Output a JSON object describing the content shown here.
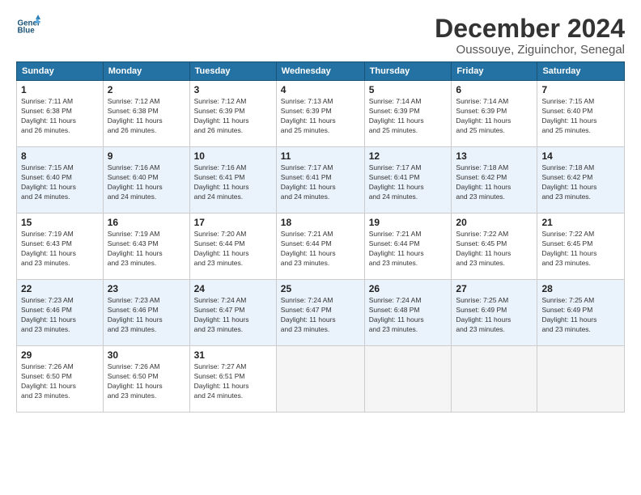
{
  "logo": {
    "line1": "General",
    "line2": "Blue"
  },
  "title": "December 2024",
  "location": "Oussouye, Ziguinchor, Senegal",
  "days_of_week": [
    "Sunday",
    "Monday",
    "Tuesday",
    "Wednesday",
    "Thursday",
    "Friday",
    "Saturday"
  ],
  "weeks": [
    [
      {
        "day": "1",
        "info": "Sunrise: 7:11 AM\nSunset: 6:38 PM\nDaylight: 11 hours\nand 26 minutes."
      },
      {
        "day": "2",
        "info": "Sunrise: 7:12 AM\nSunset: 6:38 PM\nDaylight: 11 hours\nand 26 minutes."
      },
      {
        "day": "3",
        "info": "Sunrise: 7:12 AM\nSunset: 6:39 PM\nDaylight: 11 hours\nand 26 minutes."
      },
      {
        "day": "4",
        "info": "Sunrise: 7:13 AM\nSunset: 6:39 PM\nDaylight: 11 hours\nand 25 minutes."
      },
      {
        "day": "5",
        "info": "Sunrise: 7:14 AM\nSunset: 6:39 PM\nDaylight: 11 hours\nand 25 minutes."
      },
      {
        "day": "6",
        "info": "Sunrise: 7:14 AM\nSunset: 6:39 PM\nDaylight: 11 hours\nand 25 minutes."
      },
      {
        "day": "7",
        "info": "Sunrise: 7:15 AM\nSunset: 6:40 PM\nDaylight: 11 hours\nand 25 minutes."
      }
    ],
    [
      {
        "day": "8",
        "info": "Sunrise: 7:15 AM\nSunset: 6:40 PM\nDaylight: 11 hours\nand 24 minutes."
      },
      {
        "day": "9",
        "info": "Sunrise: 7:16 AM\nSunset: 6:40 PM\nDaylight: 11 hours\nand 24 minutes."
      },
      {
        "day": "10",
        "info": "Sunrise: 7:16 AM\nSunset: 6:41 PM\nDaylight: 11 hours\nand 24 minutes."
      },
      {
        "day": "11",
        "info": "Sunrise: 7:17 AM\nSunset: 6:41 PM\nDaylight: 11 hours\nand 24 minutes."
      },
      {
        "day": "12",
        "info": "Sunrise: 7:17 AM\nSunset: 6:41 PM\nDaylight: 11 hours\nand 24 minutes."
      },
      {
        "day": "13",
        "info": "Sunrise: 7:18 AM\nSunset: 6:42 PM\nDaylight: 11 hours\nand 23 minutes."
      },
      {
        "day": "14",
        "info": "Sunrise: 7:18 AM\nSunset: 6:42 PM\nDaylight: 11 hours\nand 23 minutes."
      }
    ],
    [
      {
        "day": "15",
        "info": "Sunrise: 7:19 AM\nSunset: 6:43 PM\nDaylight: 11 hours\nand 23 minutes."
      },
      {
        "day": "16",
        "info": "Sunrise: 7:19 AM\nSunset: 6:43 PM\nDaylight: 11 hours\nand 23 minutes."
      },
      {
        "day": "17",
        "info": "Sunrise: 7:20 AM\nSunset: 6:44 PM\nDaylight: 11 hours\nand 23 minutes."
      },
      {
        "day": "18",
        "info": "Sunrise: 7:21 AM\nSunset: 6:44 PM\nDaylight: 11 hours\nand 23 minutes."
      },
      {
        "day": "19",
        "info": "Sunrise: 7:21 AM\nSunset: 6:44 PM\nDaylight: 11 hours\nand 23 minutes."
      },
      {
        "day": "20",
        "info": "Sunrise: 7:22 AM\nSunset: 6:45 PM\nDaylight: 11 hours\nand 23 minutes."
      },
      {
        "day": "21",
        "info": "Sunrise: 7:22 AM\nSunset: 6:45 PM\nDaylight: 11 hours\nand 23 minutes."
      }
    ],
    [
      {
        "day": "22",
        "info": "Sunrise: 7:23 AM\nSunset: 6:46 PM\nDaylight: 11 hours\nand 23 minutes."
      },
      {
        "day": "23",
        "info": "Sunrise: 7:23 AM\nSunset: 6:46 PM\nDaylight: 11 hours\nand 23 minutes."
      },
      {
        "day": "24",
        "info": "Sunrise: 7:24 AM\nSunset: 6:47 PM\nDaylight: 11 hours\nand 23 minutes."
      },
      {
        "day": "25",
        "info": "Sunrise: 7:24 AM\nSunset: 6:47 PM\nDaylight: 11 hours\nand 23 minutes."
      },
      {
        "day": "26",
        "info": "Sunrise: 7:24 AM\nSunset: 6:48 PM\nDaylight: 11 hours\nand 23 minutes."
      },
      {
        "day": "27",
        "info": "Sunrise: 7:25 AM\nSunset: 6:49 PM\nDaylight: 11 hours\nand 23 minutes."
      },
      {
        "day": "28",
        "info": "Sunrise: 7:25 AM\nSunset: 6:49 PM\nDaylight: 11 hours\nand 23 minutes."
      }
    ],
    [
      {
        "day": "29",
        "info": "Sunrise: 7:26 AM\nSunset: 6:50 PM\nDaylight: 11 hours\nand 23 minutes."
      },
      {
        "day": "30",
        "info": "Sunrise: 7:26 AM\nSunset: 6:50 PM\nDaylight: 11 hours\nand 23 minutes."
      },
      {
        "day": "31",
        "info": "Sunrise: 7:27 AM\nSunset: 6:51 PM\nDaylight: 11 hours\nand 24 minutes."
      },
      {
        "day": "",
        "info": ""
      },
      {
        "day": "",
        "info": ""
      },
      {
        "day": "",
        "info": ""
      },
      {
        "day": "",
        "info": ""
      }
    ]
  ]
}
